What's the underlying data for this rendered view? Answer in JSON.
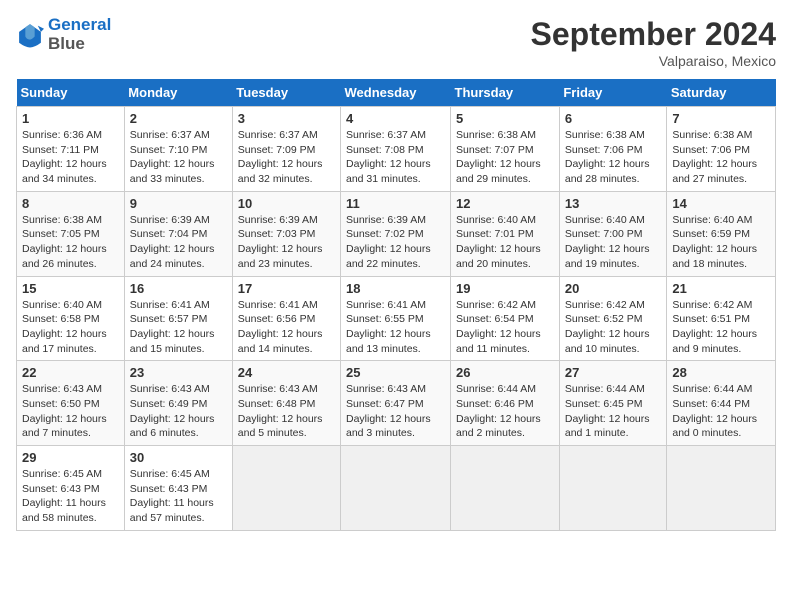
{
  "header": {
    "logo_line1": "General",
    "logo_line2": "Blue",
    "month_title": "September 2024",
    "location": "Valparaiso, Mexico"
  },
  "days_of_week": [
    "Sunday",
    "Monday",
    "Tuesday",
    "Wednesday",
    "Thursday",
    "Friday",
    "Saturday"
  ],
  "weeks": [
    [
      {
        "day": "1",
        "sunrise": "6:36 AM",
        "sunset": "7:11 PM",
        "daylight": "12 hours and 34 minutes."
      },
      {
        "day": "2",
        "sunrise": "6:37 AM",
        "sunset": "7:10 PM",
        "daylight": "12 hours and 33 minutes."
      },
      {
        "day": "3",
        "sunrise": "6:37 AM",
        "sunset": "7:09 PM",
        "daylight": "12 hours and 32 minutes."
      },
      {
        "day": "4",
        "sunrise": "6:37 AM",
        "sunset": "7:08 PM",
        "daylight": "12 hours and 31 minutes."
      },
      {
        "day": "5",
        "sunrise": "6:38 AM",
        "sunset": "7:07 PM",
        "daylight": "12 hours and 29 minutes."
      },
      {
        "day": "6",
        "sunrise": "6:38 AM",
        "sunset": "7:06 PM",
        "daylight": "12 hours and 28 minutes."
      },
      {
        "day": "7",
        "sunrise": "6:38 AM",
        "sunset": "7:06 PM",
        "daylight": "12 hours and 27 minutes."
      }
    ],
    [
      {
        "day": "8",
        "sunrise": "6:38 AM",
        "sunset": "7:05 PM",
        "daylight": "12 hours and 26 minutes."
      },
      {
        "day": "9",
        "sunrise": "6:39 AM",
        "sunset": "7:04 PM",
        "daylight": "12 hours and 24 minutes."
      },
      {
        "day": "10",
        "sunrise": "6:39 AM",
        "sunset": "7:03 PM",
        "daylight": "12 hours and 23 minutes."
      },
      {
        "day": "11",
        "sunrise": "6:39 AM",
        "sunset": "7:02 PM",
        "daylight": "12 hours and 22 minutes."
      },
      {
        "day": "12",
        "sunrise": "6:40 AM",
        "sunset": "7:01 PM",
        "daylight": "12 hours and 20 minutes."
      },
      {
        "day": "13",
        "sunrise": "6:40 AM",
        "sunset": "7:00 PM",
        "daylight": "12 hours and 19 minutes."
      },
      {
        "day": "14",
        "sunrise": "6:40 AM",
        "sunset": "6:59 PM",
        "daylight": "12 hours and 18 minutes."
      }
    ],
    [
      {
        "day": "15",
        "sunrise": "6:40 AM",
        "sunset": "6:58 PM",
        "daylight": "12 hours and 17 minutes."
      },
      {
        "day": "16",
        "sunrise": "6:41 AM",
        "sunset": "6:57 PM",
        "daylight": "12 hours and 15 minutes."
      },
      {
        "day": "17",
        "sunrise": "6:41 AM",
        "sunset": "6:56 PM",
        "daylight": "12 hours and 14 minutes."
      },
      {
        "day": "18",
        "sunrise": "6:41 AM",
        "sunset": "6:55 PM",
        "daylight": "12 hours and 13 minutes."
      },
      {
        "day": "19",
        "sunrise": "6:42 AM",
        "sunset": "6:54 PM",
        "daylight": "12 hours and 11 minutes."
      },
      {
        "day": "20",
        "sunrise": "6:42 AM",
        "sunset": "6:52 PM",
        "daylight": "12 hours and 10 minutes."
      },
      {
        "day": "21",
        "sunrise": "6:42 AM",
        "sunset": "6:51 PM",
        "daylight": "12 hours and 9 minutes."
      }
    ],
    [
      {
        "day": "22",
        "sunrise": "6:43 AM",
        "sunset": "6:50 PM",
        "daylight": "12 hours and 7 minutes."
      },
      {
        "day": "23",
        "sunrise": "6:43 AM",
        "sunset": "6:49 PM",
        "daylight": "12 hours and 6 minutes."
      },
      {
        "day": "24",
        "sunrise": "6:43 AM",
        "sunset": "6:48 PM",
        "daylight": "12 hours and 5 minutes."
      },
      {
        "day": "25",
        "sunrise": "6:43 AM",
        "sunset": "6:47 PM",
        "daylight": "12 hours and 3 minutes."
      },
      {
        "day": "26",
        "sunrise": "6:44 AM",
        "sunset": "6:46 PM",
        "daylight": "12 hours and 2 minutes."
      },
      {
        "day": "27",
        "sunrise": "6:44 AM",
        "sunset": "6:45 PM",
        "daylight": "12 hours and 1 minute."
      },
      {
        "day": "28",
        "sunrise": "6:44 AM",
        "sunset": "6:44 PM",
        "daylight": "12 hours and 0 minutes."
      }
    ],
    [
      {
        "day": "29",
        "sunrise": "6:45 AM",
        "sunset": "6:43 PM",
        "daylight": "11 hours and 58 minutes."
      },
      {
        "day": "30",
        "sunrise": "6:45 AM",
        "sunset": "6:43 PM",
        "daylight": "11 hours and 57 minutes."
      },
      null,
      null,
      null,
      null,
      null
    ]
  ]
}
